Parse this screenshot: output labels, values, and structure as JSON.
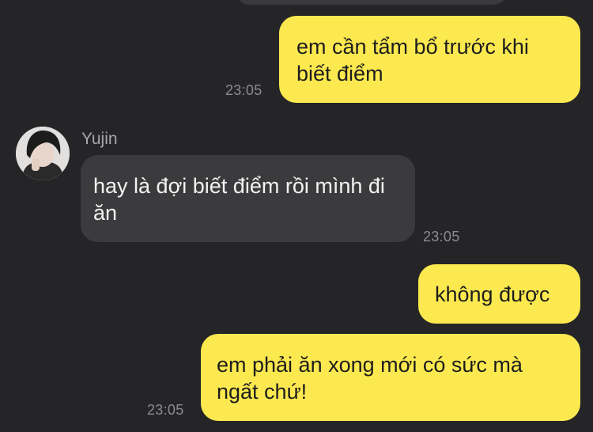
{
  "messages": [
    {
      "type": "outgoing",
      "text": "em cần tẩm bổ trước khi biết điểm",
      "time": "23:05"
    },
    {
      "type": "incoming",
      "sender": "Yujin",
      "text": "hay là đợi biết điểm rồi mình đi ăn",
      "time": "23:05"
    },
    {
      "type": "outgoing",
      "text": "không được"
    },
    {
      "type": "outgoing",
      "text": "em phải ăn xong mới có sức mà ngất chứ!",
      "time": "23:05"
    }
  ],
  "colors": {
    "background": "#252527",
    "outgoing_bubble": "#fce94f",
    "incoming_bubble": "#3b3b3d",
    "timestamp": "#8c8c8e"
  },
  "icons": {
    "avatar": "profile-photo-avatar"
  }
}
